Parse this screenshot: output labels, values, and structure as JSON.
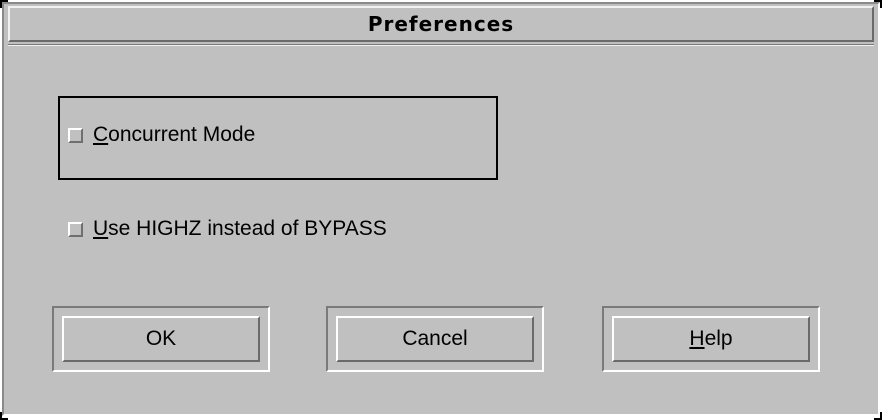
{
  "dialog": {
    "title": "Preferences"
  },
  "options": {
    "concurrent_mode": {
      "mnemonic": "C",
      "rest": "oncurrent Mode",
      "checked": false
    },
    "use_highz": {
      "mnemonic": "U",
      "rest": "se HIGHZ instead of BYPASS",
      "checked": false
    }
  },
  "buttons": {
    "ok": "OK",
    "cancel": "Cancel",
    "help_mnemonic": "H",
    "help_rest": "elp"
  },
  "colors": {
    "background": "#c0c0c0",
    "text": "#000000"
  }
}
